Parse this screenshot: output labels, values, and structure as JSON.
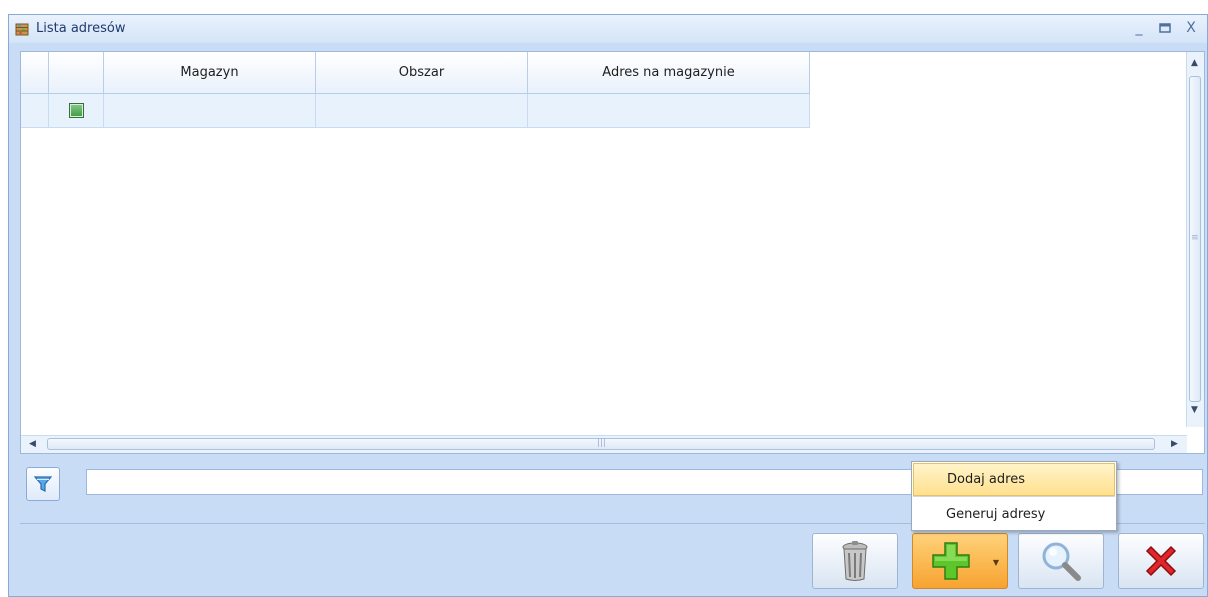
{
  "window": {
    "title": "Lista adresów",
    "controls": [
      "minimize-icon",
      "maximize-icon",
      "close-icon"
    ]
  },
  "grid": {
    "columns": [
      "",
      "",
      "Magazyn",
      "Obszar",
      "Adres na magazynie"
    ],
    "rows": [
      {
        "indicator": "",
        "check": "green-square-icon",
        "magazyn": "",
        "obszar": "",
        "adres": ""
      }
    ]
  },
  "filter": {
    "icon": "funnel-icon",
    "value": ""
  },
  "toolbar": {
    "buttons": [
      {
        "name": "delete-button",
        "icon": "trash-icon"
      },
      {
        "name": "add-split-button",
        "icon": "plus-icon",
        "dropdown": "chevron-down-icon"
      },
      {
        "name": "search-button",
        "icon": "magnifier-icon"
      },
      {
        "name": "close-button",
        "icon": "red-x-icon"
      }
    ]
  },
  "dropdown_menu": {
    "items": [
      {
        "label": "Dodaj adres",
        "highlighted": true
      },
      {
        "label": "Generuj adresy",
        "highlighted": false
      }
    ]
  },
  "colors": {
    "window_bg": "#c8dcf5",
    "title_text": "#1e3a6e",
    "row_bg": "#e8f2fd",
    "add_button": "#f7a330",
    "menu_highlight": "#ffe08f",
    "close_red": "#e0262a",
    "plus_green": "#5cc62a"
  }
}
